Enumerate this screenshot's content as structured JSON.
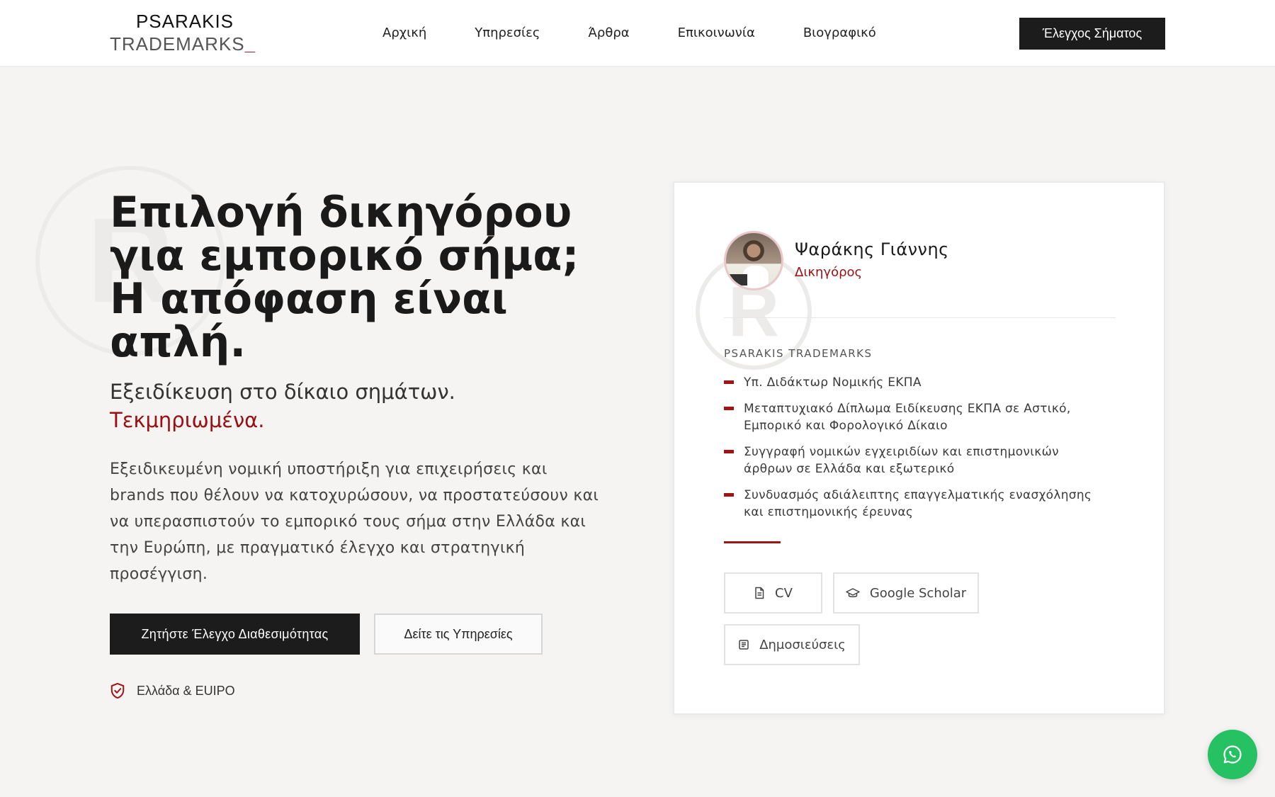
{
  "header": {
    "logo_top": "PSARAKIS",
    "logo_bottom": "TRADEMARKS",
    "logo_underscore": "_",
    "nav": [
      "Αρχική",
      "Υπηρεσίες",
      "Άρθρα",
      "Επικοινωνία",
      "Βιογραφικό"
    ],
    "cta_label": "Έλεγχος Σήματος"
  },
  "hero": {
    "title": "Επιλογή δικηγόρου για εμπορικό σήμα; Η απόφαση είναι απλή.",
    "subtitle": "Εξειδίκευση στο δίκαιο σημάτων.",
    "subtitle_accent": "Τεκμηριωμένα.",
    "description": "Εξειδικευμένη νομική υποστήριξη για επιχειρήσεις και brands που θέλουν να κατοχυρώσουν, να προστατεύσουν και να υπερασπιστούν το εμπορικό τους σήμα στην Ελλάδα και την Ευρώπη, με πραγματικό έλεγχο και στρατηγική προσέγγιση.",
    "primary_button": "Ζητήστε Έλεγχο Διαθεσιμότητας",
    "secondary_button": "Δείτε τις Υπηρεσίες",
    "region_label": "Ελλάδα & EUIPO",
    "bg_mark": "R"
  },
  "profile_card": {
    "name": "Ψαράκης Γιάννης",
    "role": "Δικηγόρος",
    "firm": "PSARAKIS TRADEMARKS",
    "qualifications": [
      "Υπ. Διδάκτωρ Νομικής ΕΚΠΑ",
      "Μεταπτυχιακό Δίπλωμα Ειδίκευσης ΕΚΠΑ σε Αστικό, Εμπορικό και Φορολογικό Δίκαιο",
      "Συγγραφή νομικών εγχειριδίων και επιστημονικών άρθρων σε Ελλάδα και εξωτερικό",
      "Συνδυασμός αδιάλειπτης επαγγελματικής ενασχόλησης και επιστημονικής έρευνας"
    ],
    "links": {
      "cv": "CV",
      "scholar": "Google Scholar",
      "publications": "Δημοσιεύσεις"
    },
    "bg_mark": "R"
  },
  "colors": {
    "accent": "#9a1010",
    "dark_button": "#1c1c1c",
    "whatsapp": "#25c163"
  },
  "icons": {
    "region": "shield-check-icon",
    "cv": "document-icon",
    "scholar": "graduation-cap-icon",
    "publications": "list-document-icon",
    "chat": "whatsapp-icon"
  }
}
